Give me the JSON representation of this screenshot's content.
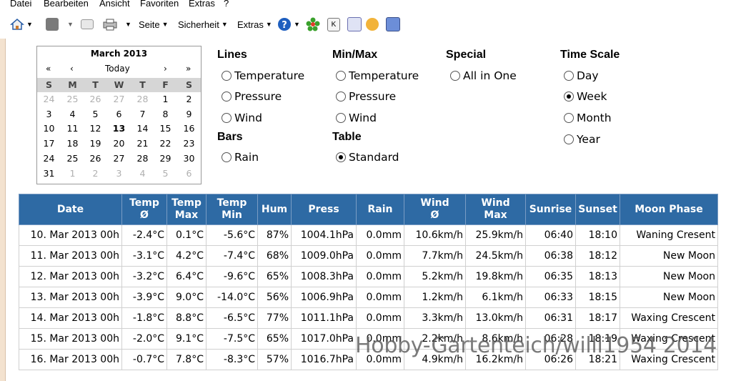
{
  "menu": [
    "Datei",
    "Bearbeiten",
    "Ansicht",
    "Favoriten",
    "Extras",
    "?"
  ],
  "toolbar": {
    "page_label": "Seite",
    "security_label": "Sicherheit",
    "extras_label": "Extras"
  },
  "calendar": {
    "title": "March 2013",
    "prev_year": "«",
    "prev_month": "‹",
    "today_label": "Today",
    "next_month": "›",
    "next_year": "»",
    "weekdays": [
      "S",
      "M",
      "T",
      "W",
      "T",
      "F",
      "S"
    ],
    "weeks": [
      [
        "24",
        "25",
        "26",
        "27",
        "28",
        "1",
        "2"
      ],
      [
        "3",
        "4",
        "5",
        "6",
        "7",
        "8",
        "9"
      ],
      [
        "10",
        "11",
        "12",
        "13",
        "14",
        "15",
        "16"
      ],
      [
        "17",
        "18",
        "19",
        "20",
        "21",
        "22",
        "23"
      ],
      [
        "24",
        "25",
        "26",
        "27",
        "28",
        "29",
        "30"
      ],
      [
        "31",
        "1",
        "2",
        "3",
        "4",
        "5",
        "6"
      ]
    ],
    "selected_day": "13"
  },
  "options": {
    "lines": {
      "title": "Lines",
      "items": [
        "Temperature",
        "Pressure",
        "Wind"
      ]
    },
    "bars": {
      "title": "Bars",
      "items": [
        "Rain"
      ]
    },
    "minmax": {
      "title": "Min/Max",
      "items": [
        "Temperature",
        "Pressure",
        "Wind"
      ]
    },
    "table": {
      "title": "Table",
      "items": [
        "Standard"
      ],
      "selected": "Standard"
    },
    "special": {
      "title": "Special",
      "items": [
        "All in One"
      ]
    },
    "timescale": {
      "title": "Time Scale",
      "items": [
        "Day",
        "Week",
        "Month",
        "Year"
      ],
      "selected": "Week"
    }
  },
  "table": {
    "headers": [
      "Date",
      "Temp\nØ",
      "Temp\nMax",
      "Temp\nMin",
      "Hum",
      "Press",
      "Rain",
      "Wind\nØ",
      "Wind\nMax",
      "Sunrise",
      "Sunset",
      "Moon Phase"
    ],
    "rows": [
      [
        "10. Mar 2013 00h",
        "-2.4°C",
        "0.1°C",
        "-5.6°C",
        "87%",
        "1004.1hPa",
        "0.0mm",
        "10.6km/h",
        "25.9km/h",
        "06:40",
        "18:10",
        "Waning Cresent"
      ],
      [
        "11. Mar 2013 00h",
        "-3.1°C",
        "4.2°C",
        "-7.4°C",
        "68%",
        "1009.0hPa",
        "0.0mm",
        "7.7km/h",
        "24.5km/h",
        "06:38",
        "18:12",
        "New Moon"
      ],
      [
        "12. Mar 2013 00h",
        "-3.2°C",
        "6.4°C",
        "-9.6°C",
        "65%",
        "1008.3hPa",
        "0.0mm",
        "5.2km/h",
        "19.8km/h",
        "06:35",
        "18:13",
        "New Moon"
      ],
      [
        "13. Mar 2013 00h",
        "-3.9°C",
        "9.0°C",
        "-14.0°C",
        "56%",
        "1006.9hPa",
        "0.0mm",
        "1.2km/h",
        "6.1km/h",
        "06:33",
        "18:15",
        "New Moon"
      ],
      [
        "14. Mar 2013 00h",
        "-1.8°C",
        "8.8°C",
        "-6.5°C",
        "77%",
        "1011.1hPa",
        "0.0mm",
        "3.3km/h",
        "13.0km/h",
        "06:31",
        "18:17",
        "Waxing Crescent"
      ],
      [
        "15. Mar 2013 00h",
        "-2.0°C",
        "9.1°C",
        "-7.5°C",
        "65%",
        "1017.0hPa",
        "0.0mm",
        "2.2km/h",
        "8.6km/h",
        "06:28",
        "18:19",
        "Waxing Crescent"
      ],
      [
        "16. Mar 2013 00h",
        "-0.7°C",
        "7.8°C",
        "-8.3°C",
        "57%",
        "1016.7hPa",
        "0.0mm",
        "4.9km/h",
        "16.2km/h",
        "06:26",
        "18:21",
        "Waxing Crescent"
      ]
    ]
  },
  "watermark": "Hobby-Gartenteich/willi1954 2014",
  "colors": {
    "header_bg": "#2e6aa4",
    "calendar_head": "#d6d6d6"
  }
}
